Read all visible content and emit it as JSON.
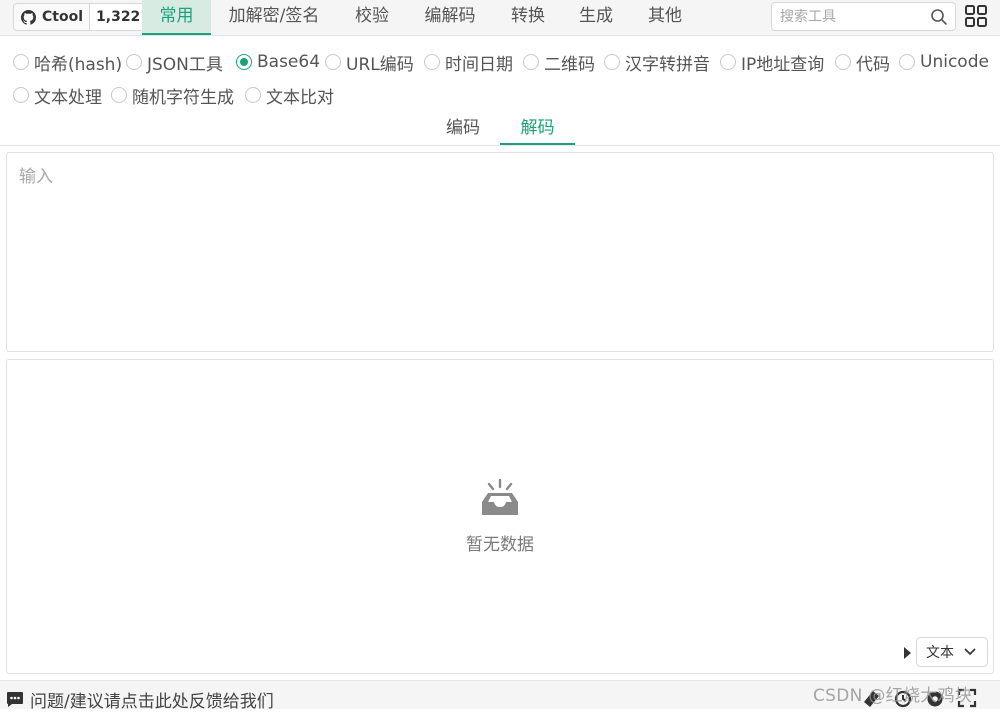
{
  "header": {
    "repo_name": "Ctool",
    "star_count": "1,322",
    "nav_tabs": [
      "常用",
      "加解密/签名",
      "校验",
      "编解码",
      "转换",
      "生成",
      "其他"
    ],
    "active_tab": "常用",
    "search_placeholder": "搜索工具",
    "icons": [
      "github-icon",
      "search-icon",
      "grid-icon"
    ]
  },
  "tools": {
    "items": [
      "哈希(hash)",
      "JSON工具",
      "Base64",
      "URL编码",
      "时间日期",
      "二维码",
      "汉字转拼音",
      "IP地址查询",
      "代码",
      "Unicode",
      "文本处理",
      "随机字符生成",
      "文本比对"
    ],
    "selected": "Base64"
  },
  "subtabs": {
    "items": [
      "编码",
      "解码"
    ],
    "active": "解码"
  },
  "input": {
    "placeholder": "输入",
    "value": ""
  },
  "output": {
    "empty_text": "暂无数据",
    "format_value": "文本"
  },
  "footer": {
    "feedback_text": "问题/建议请点击此处反馈给我们",
    "watermark": "CSDN @红烧大鸡块"
  },
  "colors": {
    "accent": "#1aa37a",
    "active_tab_bg": "#d7ebe3",
    "bar_bg": "#f5f5f5"
  }
}
